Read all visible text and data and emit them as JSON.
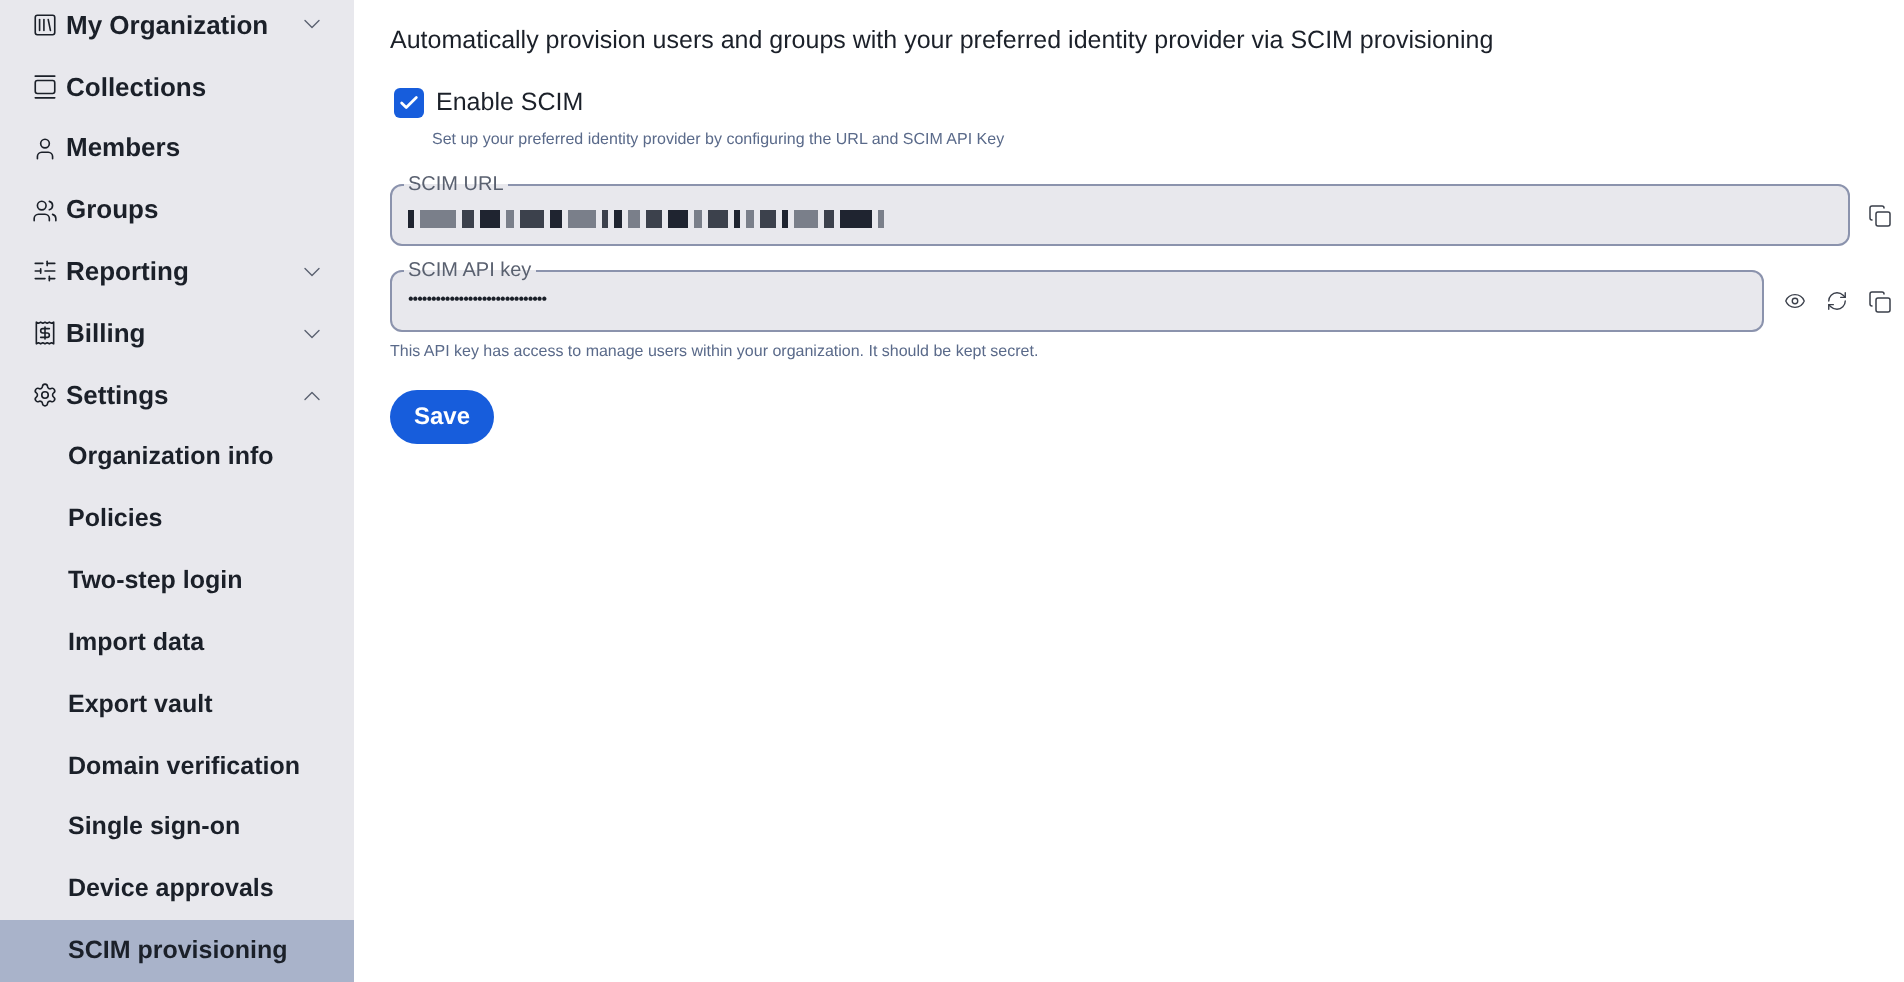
{
  "sidebar": {
    "items": [
      {
        "label": "My Organization",
        "expanded": false
      },
      {
        "label": "Collections"
      },
      {
        "label": "Members"
      },
      {
        "label": "Groups"
      },
      {
        "label": "Reporting",
        "expanded": false
      },
      {
        "label": "Billing",
        "expanded": false
      },
      {
        "label": "Settings",
        "expanded": true,
        "children": [
          {
            "label": "Organization info",
            "selected": false
          },
          {
            "label": "Policies",
            "selected": false
          },
          {
            "label": "Two-step login",
            "selected": false
          },
          {
            "label": "Import data",
            "selected": false
          },
          {
            "label": "Export vault",
            "selected": false
          },
          {
            "label": "Domain verification",
            "selected": false
          },
          {
            "label": "Single sign-on",
            "selected": false
          },
          {
            "label": "Device approvals",
            "selected": false
          },
          {
            "label": "SCIM provisioning",
            "selected": true
          }
        ]
      }
    ]
  },
  "main": {
    "description": "Automatically provision users and groups with your preferred identity provider via SCIM provisioning",
    "enable_scim": {
      "label": "Enable SCIM",
      "checked": true,
      "hint": "Set up your preferred identity provider by configuring the URL and SCIM API Key"
    },
    "scim_url": {
      "label": "SCIM URL"
    },
    "scim_api_key": {
      "label": "SCIM API key",
      "value": "••••••••••••••••••••••••••••••",
      "hint": "This API key has access to manage users within your organization. It should be kept secret."
    },
    "save_button": "Save"
  }
}
